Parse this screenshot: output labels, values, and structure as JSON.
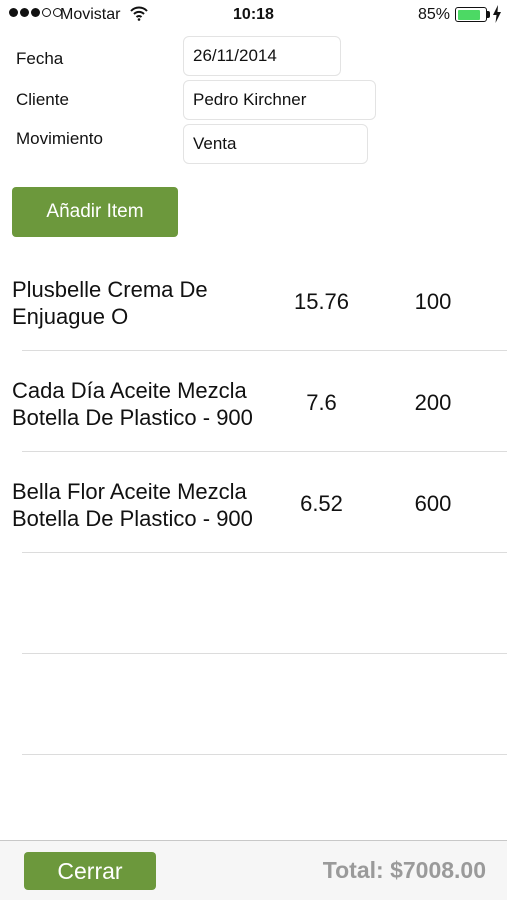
{
  "status_bar": {
    "carrier": "Movistar",
    "time": "10:18",
    "battery": "85%",
    "battery_level": 0.85,
    "signal_bars_filled": 3,
    "signal_bars_total": 5
  },
  "form": {
    "fecha_label": "Fecha",
    "fecha_value": "26/11/2014",
    "cliente_label": "Cliente",
    "cliente_value": "Pedro Kirchner",
    "movimiento_label": "Movimiento",
    "movimiento_value": "Venta"
  },
  "add_button_label": "Añadir Item",
  "items": [
    {
      "name": "Plusbelle Crema De Enjuague O",
      "price": "15.76",
      "qty": "100"
    },
    {
      "name": "Cada Día Aceite Mezcla Botella De Plastico - 900",
      "price": "7.6",
      "qty": "200"
    },
    {
      "name": "Bella Flor Aceite Mezcla Botella De Plastico - 900",
      "price": "6.52",
      "qty": "600"
    }
  ],
  "toolbar": {
    "close_label": "Cerrar",
    "total": "Total: $7008.00"
  },
  "colors": {
    "accent": "#6c983c",
    "battery": "#4cd964",
    "total_text": "#9a9a9a"
  }
}
